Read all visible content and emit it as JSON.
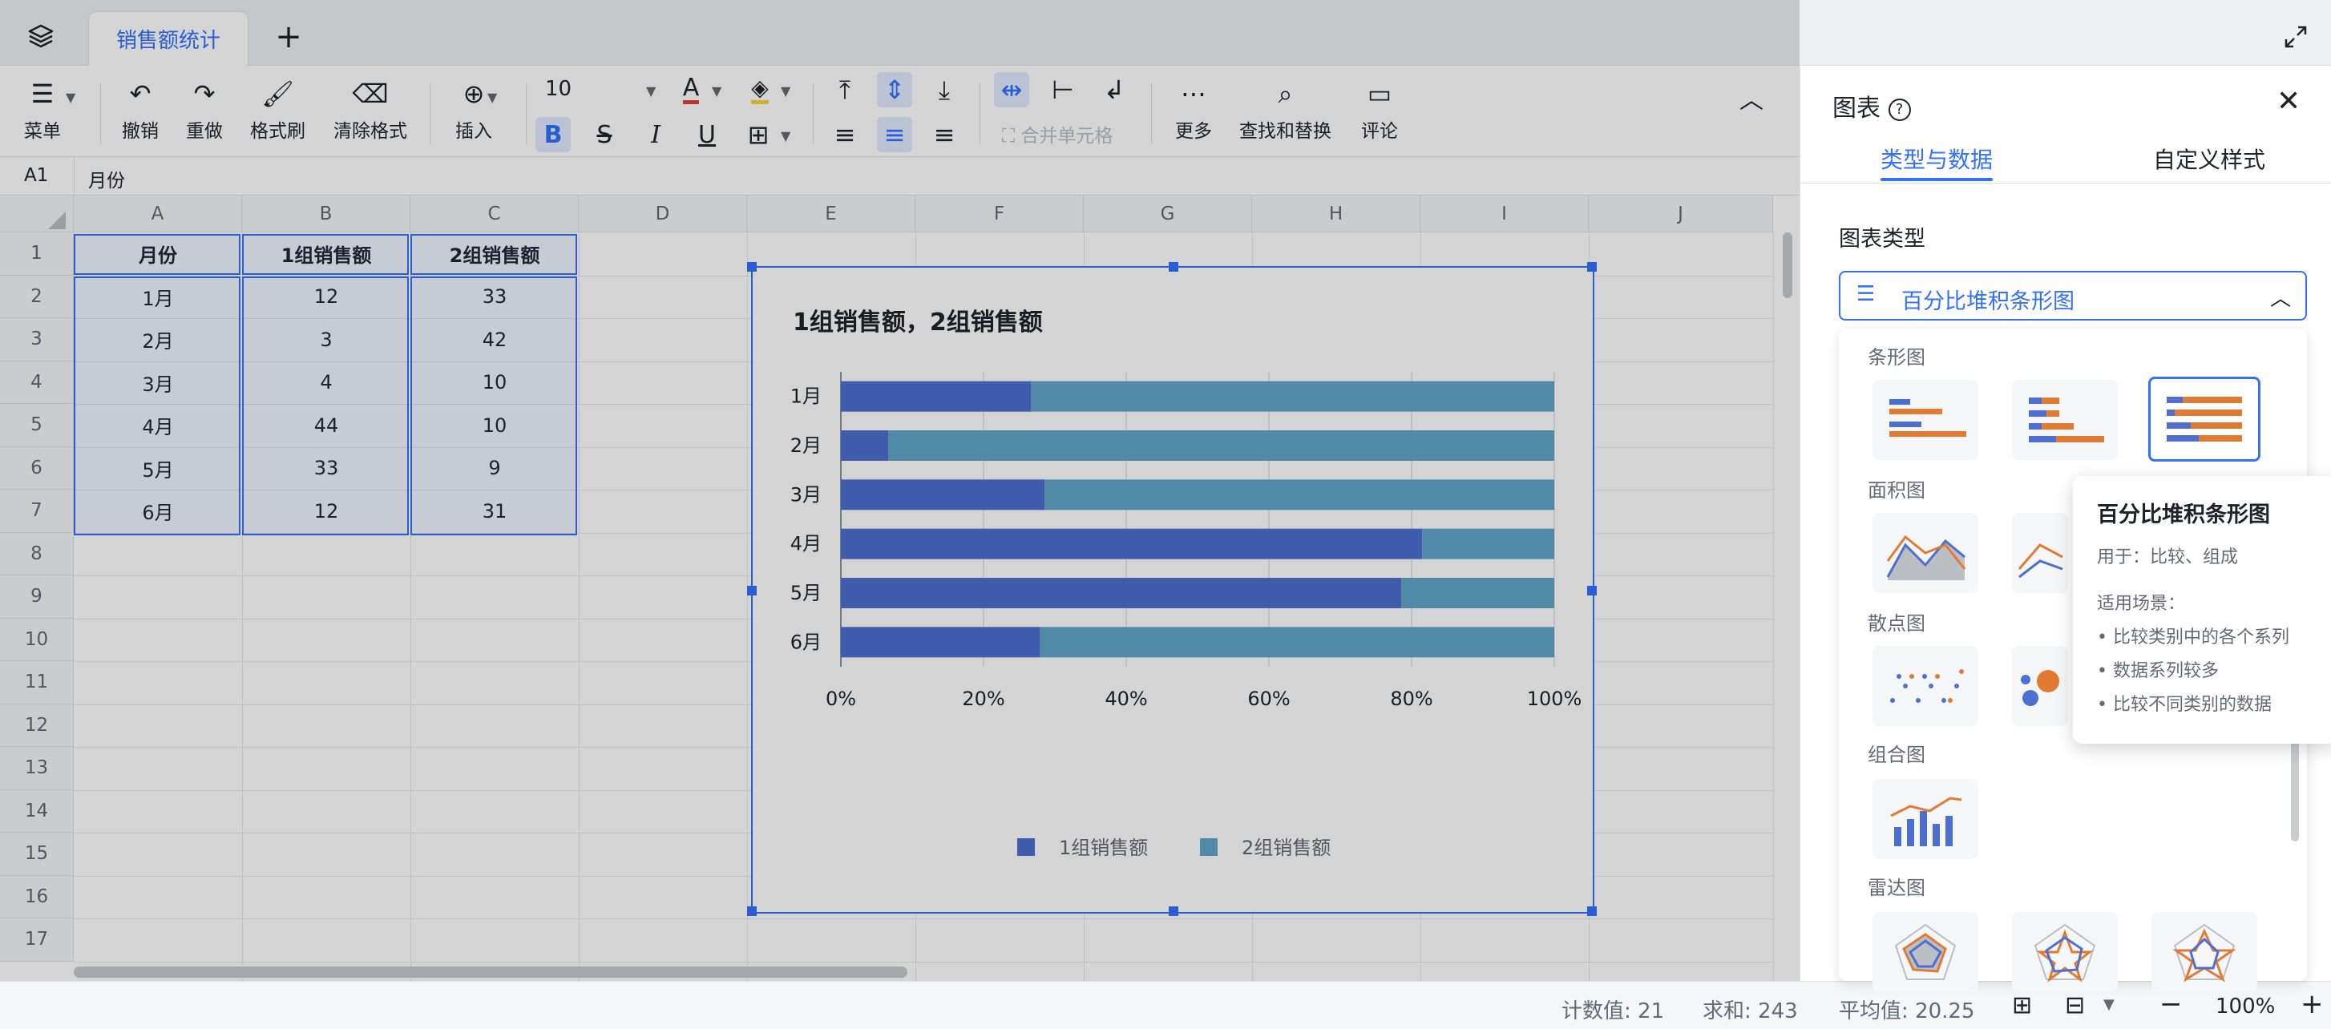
{
  "tabs": [
    {
      "label": "销售额统计"
    }
  ],
  "toolbar": {
    "menu": "菜单",
    "undo": "撤销",
    "redo": "重做",
    "format_painter": "格式刷",
    "clear_format": "清除格式",
    "insert": "插入",
    "font_size": "10",
    "merge_cells": "合并单元格",
    "more": "更多",
    "find_replace": "查找和替换",
    "comment": "评论"
  },
  "formula": {
    "cell_ref": "A1",
    "value": "月份"
  },
  "columns": [
    "A",
    "B",
    "C",
    "D",
    "E",
    "F",
    "G",
    "H",
    "I",
    "J"
  ],
  "rows": [
    "1",
    "2",
    "3",
    "4",
    "5",
    "6",
    "7",
    "8",
    "9",
    "10",
    "11",
    "12",
    "13",
    "14",
    "15",
    "16",
    "17"
  ],
  "table": {
    "headers": [
      "月份",
      "1组销售额",
      "2组销售额"
    ],
    "rows": [
      [
        "1月",
        "12",
        "33"
      ],
      [
        "2月",
        "3",
        "42"
      ],
      [
        "3月",
        "4",
        "10"
      ],
      [
        "4月",
        "44",
        "10"
      ],
      [
        "5月",
        "33",
        "9"
      ],
      [
        "6月",
        "12",
        "31"
      ]
    ]
  },
  "chart_data": {
    "type": "bar",
    "title": "1组销售额，2组销售额",
    "categories": [
      "1月",
      "2月",
      "3月",
      "4月",
      "5月",
      "6月"
    ],
    "series": [
      {
        "name": "1组销售额",
        "values": [
          12,
          3,
          4,
          44,
          33,
          12
        ]
      },
      {
        "name": "2组销售额",
        "values": [
          33,
          42,
          10,
          10,
          9,
          31
        ]
      }
    ],
    "x_ticks": [
      "0%",
      "20%",
      "40%",
      "60%",
      "80%",
      "100%"
    ],
    "stacking": "percent",
    "orientation": "horizontal",
    "legend": "bottom",
    "grid": true,
    "colors": [
      "#4e6fd1",
      "#62a7cb"
    ]
  },
  "status": {
    "count": "计数值: 21",
    "sum": "求和: 243",
    "avg": "平均值: 20.25",
    "zoom": "100%"
  },
  "panel": {
    "title": "图表",
    "tab_type": "类型与数据",
    "tab_style": "自定义样式",
    "section_chart_type": "图表类型",
    "selected_type": "百分比堆积条形图",
    "categories": {
      "bar": "条形图",
      "area": "面积图",
      "scatter": "散点图",
      "combo": "组合图",
      "radar": "雷达图"
    }
  },
  "tooltip": {
    "title": "百分比堆积条形图",
    "usage": "用于：比较、组成",
    "scenario_title": "适用场景：",
    "items": [
      "比较类别中的各个系列",
      "数据系列较多",
      "比较不同类别的数据"
    ]
  },
  "colors": {
    "accent": "#3370ff",
    "orange": "#e27b32"
  }
}
